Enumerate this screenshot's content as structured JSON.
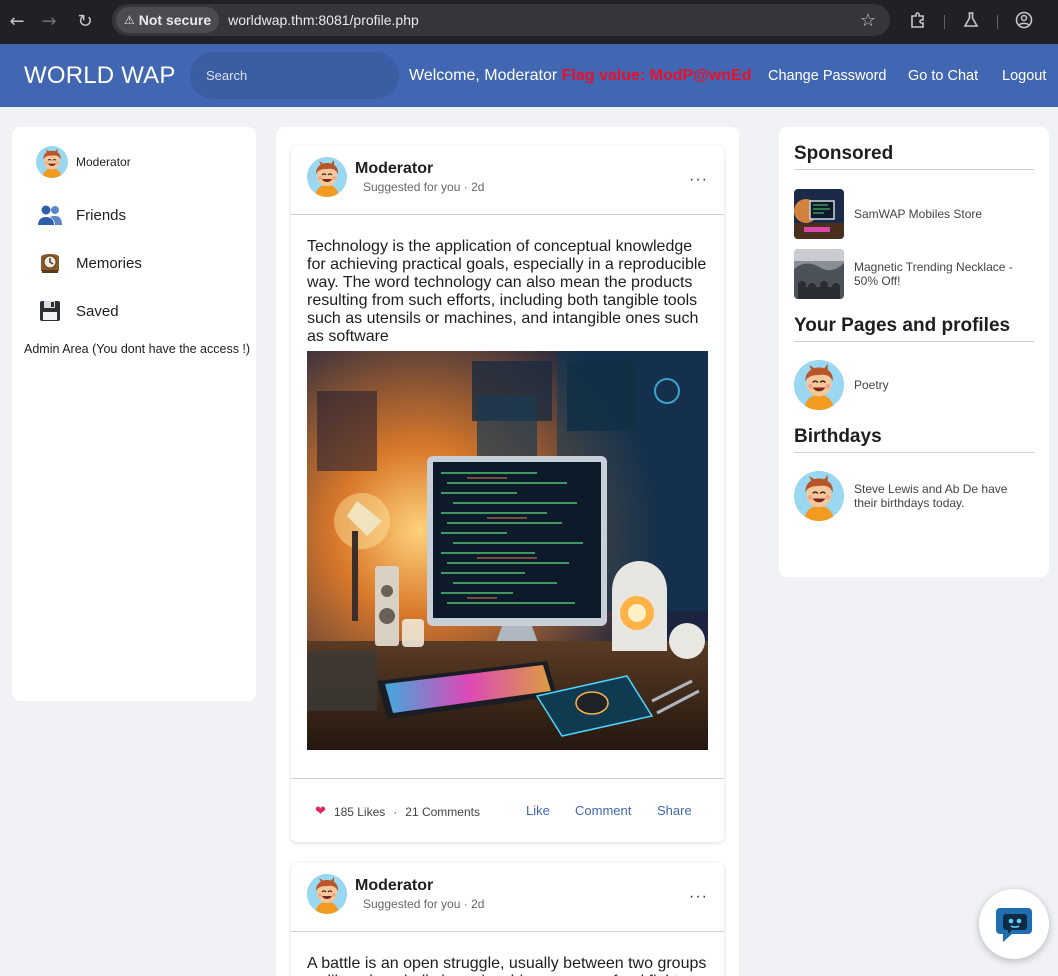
{
  "browser": {
    "security_label": "Not secure",
    "url": "worldwap.thm:8081/profile.php"
  },
  "header": {
    "logo": "WORLD WAP",
    "search_placeholder": "Search",
    "welcome": "Welcome, Moderator",
    "flag_text": "Flag value: ModP@wnEd",
    "nav": [
      "Change Password",
      "Go to Chat",
      "Logout"
    ]
  },
  "sidebar": {
    "profile_name": "Moderator",
    "items": [
      {
        "label": "Friends",
        "icon": "friends-icon"
      },
      {
        "label": "Memories",
        "icon": "clock-icon"
      },
      {
        "label": "Saved",
        "icon": "floppy-disk-icon"
      }
    ],
    "admin_text": "Admin Area (You dont have the access !)"
  },
  "posts": [
    {
      "author": "Moderator",
      "subtitle": "Suggested for you · 2d",
      "text": "Technology is the application of conceptual knowledge for achieving practical goals, especially in a reproducible way. The word technology can also mean the products resulting from such efforts, including both tangible tools such as utensils or machines, and intangible ones such as software",
      "likes": "185 Likes",
      "comments": "21 Comments",
      "actions": [
        "Like",
        "Comment",
        "Share"
      ]
    },
    {
      "author": "Moderator",
      "subtitle": "Suggested for you · 2d",
      "text": "A battle is an open struggle, usually between two groups — like a baseball championship game or a food fight"
    }
  ],
  "right": {
    "sponsored_title": "Sponsored",
    "sponsored": [
      {
        "text": "SamWAP Mobiles Store"
      },
      {
        "text": "Magnetic Trending Necklace - 50% Off!"
      }
    ],
    "pages_title": "Your Pages and profiles",
    "pages": [
      {
        "text": "Poetry"
      }
    ],
    "birthdays_title": "Birthdays",
    "birthdays": [
      {
        "text": "Steve Lewis and Ab De have their birthdays today."
      }
    ]
  },
  "colors": {
    "header_bg": "#4267b2",
    "flag": "#e8102a",
    "link": "#4267b2",
    "page_bg": "#f0f2f5"
  }
}
